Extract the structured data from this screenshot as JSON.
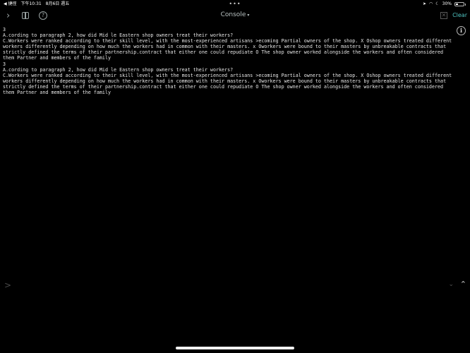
{
  "status_bar": {
    "back_app": "◀ 捷徑",
    "time": "下午10:31",
    "date": "8月6日 週五",
    "battery_text": "30%",
    "battery_level": 0.3
  },
  "toolbar": {
    "title": "Console",
    "clear_label": "Clear"
  },
  "console": {
    "lines": [
      "3",
      "A.cording to paragraph 2, how did Mid le Eastern shop owners treat their workers?",
      "C.Workers were ranked according to their skill level, with the most-experienced artisans >ecoming Partial owners of the shop. X Oshop owners treated different workers differently depending on how much the workers had in common with their masters. x Oworkers were bound to their masters by unbreakable contracts that strictly defined the terms of their partnership.contract that either one could repudiate O The shop owner worked alongside the workers and often considered them Partner and members of the family",
      "3",
      "A.cording to paragraph 2, how did Mid le Eastern shop owners treat their workers?",
      "C.Workers were ranked according to their skill level, with the most-experienced artisans >ecoming Partial owners of the shop. X Oshop owners treated different workers differently depending on how much the workers had in common with their masters. x Oworkers were bound to their masters by unbreakable contracts that strictly defined the terms of their partnership.contract that either one could repudiate O The shop owner worked alongside the workers and often considered them Partner and members of the family"
    ]
  },
  "icons": {
    "chevron": "chevron-right-icon",
    "sidebar": "sidebar-icon",
    "help": "help-icon",
    "info": "info-icon"
  }
}
